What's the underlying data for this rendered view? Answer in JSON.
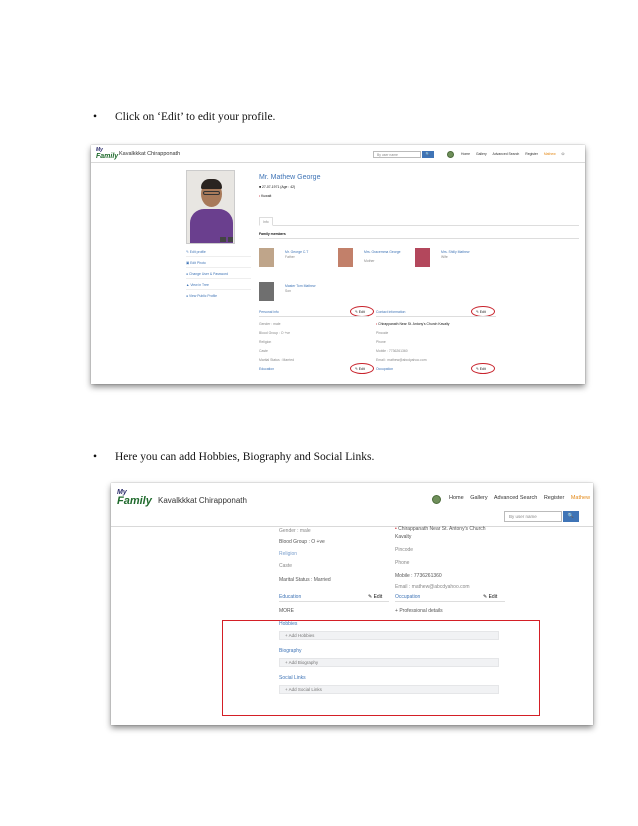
{
  "bullets": [
    {
      "symbol": "•",
      "text": "Click on ‘Edit’ to edit your profile."
    },
    {
      "symbol": "•",
      "text": "Here you can add Hobbies, Biography and Social Links."
    }
  ],
  "header": {
    "logo_line1": "My",
    "logo_line2": "Family",
    "brand": "Kavalkkkat Chirapponath",
    "brand2": "Kavalkkkat Chirapponath",
    "search_placeholder": "By user name",
    "search_placeholder2": "By user name",
    "nav": [
      "Home",
      "Gallery",
      "Advanced Search",
      "Register",
      "Mathew"
    ],
    "nav2": [
      "Home",
      "Gallery",
      "Advanced Search",
      "Register",
      "Mathew"
    ]
  },
  "profile": {
    "name": "Mr. Mathew George",
    "meta": "27-07-1971 (Age : 42)",
    "location": "Kuwait",
    "tab": "Info",
    "family_heading": "Family members"
  },
  "sidebar": [
    "Edit profile",
    "Edit Photo",
    "Change User & Password",
    "View in Tree",
    "View Public Profile"
  ],
  "family": [
    {
      "name": "Mr. George C.T",
      "rel": "Father"
    },
    {
      "name": "Mrs. Gracemma George",
      "rel": "Mother"
    },
    {
      "name": "Mrs. Shilly Mathew",
      "rel": "Wife"
    },
    {
      "name": "Master Tom Mathew",
      "rel": "Son"
    }
  ],
  "sections": {
    "personal": "Personal info",
    "contact": "Contact information",
    "education": "Education",
    "occupation": "Occupation",
    "edit": "Edit"
  },
  "personal_rows": [
    "Gender : male",
    "Blood Group : O +ve",
    "Religion",
    "Caste",
    "Marital Status : Married"
  ],
  "contact_rows": [
    "Chirappanath Near St. Antony's Church Kavalty",
    "Pincode",
    "Phone",
    "Mobile : 7736261360",
    "Email : mathew@abcdyahoo.com"
  ],
  "shot2": {
    "personal_rows": [
      "Gender : male",
      "Blood Group : O +ve",
      "Religion",
      "Caste",
      "Marital Status : Married"
    ],
    "contact_rows": [
      "Chirappanath Near St. Antony's Church",
      "Kavalty",
      "Pincode",
      "Phone",
      "Mobile : 7736261360",
      "Email : mathew@abcdyahoo.com"
    ],
    "education": "Education",
    "occupation": "Occupation",
    "edit": "Edit",
    "more": "MORE",
    "more_right": "Professional details",
    "hobbies_label": "Hobbies",
    "hobbies_btn": "+ Add Hobbies",
    "bio_label": "Biography",
    "bio_btn": "+ Add Biography",
    "social_label": "Social Links",
    "social_btn": "+ Add Social Links"
  },
  "colors": {
    "accent": "#3f74b6",
    "highlight": "#d41f26",
    "user": "#e48a19"
  }
}
